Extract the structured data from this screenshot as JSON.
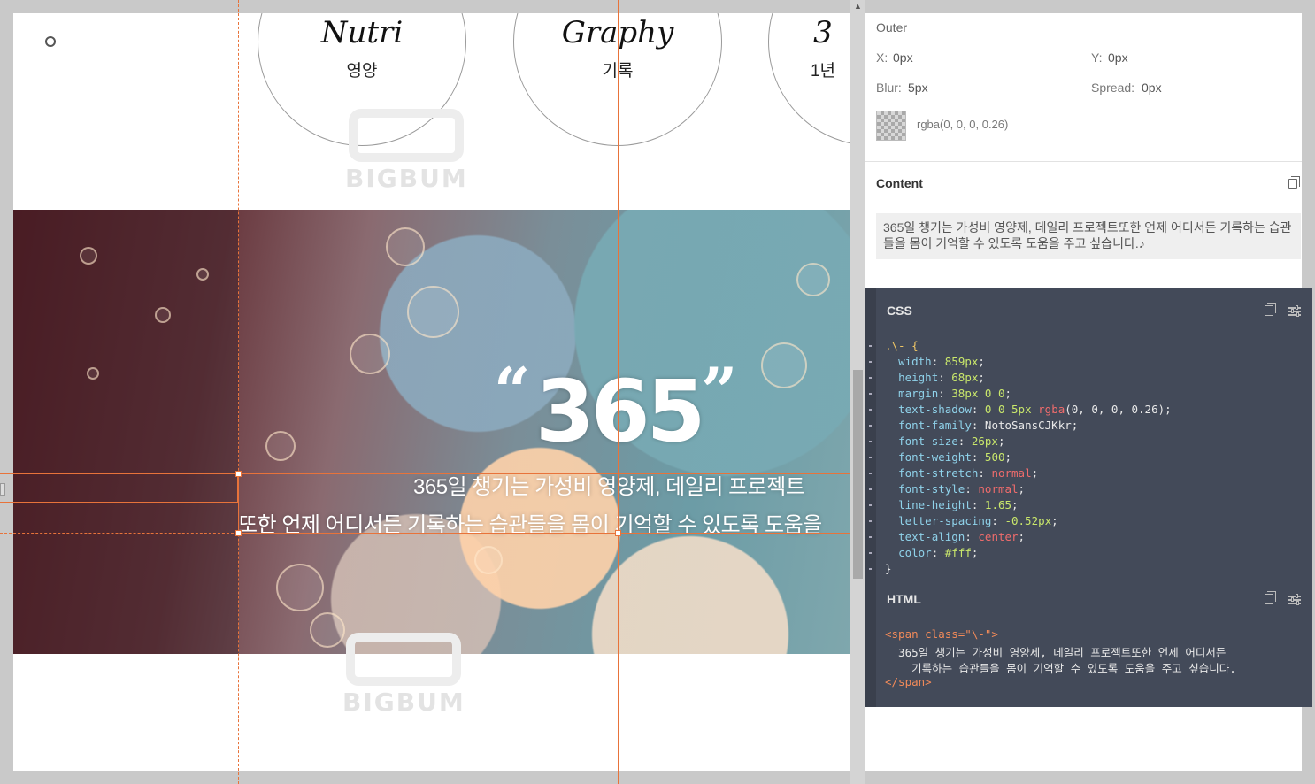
{
  "canvas": {
    "circles": [
      {
        "title": "Nutri",
        "subtitle": "영양"
      },
      {
        "title": "Graphy",
        "subtitle": "기록"
      },
      {
        "title": "3",
        "subtitle": "1년"
      }
    ],
    "watermark": "BIGBUM",
    "hero": {
      "quote_open": "“",
      "number": "365",
      "quote_close": "”",
      "line1": "365일 챙기는 가성비 영양제, 데일리 프로젝트",
      "line2": "또한 언제 어디서든 기록하는 습관들을 몸이 기억할 수 있도록 도움을"
    }
  },
  "panel": {
    "shadow": {
      "heading": "Outer",
      "x_label": "X:",
      "x_value": "0px",
      "y_label": "Y:",
      "y_value": "0px",
      "blur_label": "Blur:",
      "blur_value": "5px",
      "spread_label": "Spread:",
      "spread_value": "0px",
      "color_value": "rgba(0, 0, 0, 0.26)"
    },
    "content": {
      "heading": "Content",
      "text": "365일 챙기는 가성비 영양제, 데일리 프로젝트또한 언제 어디서든 기록하는 습관들을 몸이 기억할 수 있도록 도움을 주고 싶습니다.♪"
    },
    "css": {
      "heading": "CSS",
      "selector": ".\\- {",
      "rules": [
        {
          "prop": "width",
          "value": "859px",
          "kind": "num"
        },
        {
          "prop": "height",
          "value": "68px",
          "kind": "num"
        },
        {
          "prop": "margin",
          "value": "38px 0 0",
          "kind": "num"
        },
        {
          "prop": "text-shadow",
          "value": "0 0 5px rgba(0, 0, 0, 0.26)",
          "kind": "shadow"
        },
        {
          "prop": "font-family",
          "value": "NotoSansCJKkr",
          "kind": "plain"
        },
        {
          "prop": "font-size",
          "value": "26px",
          "kind": "num"
        },
        {
          "prop": "font-weight",
          "value": "500",
          "kind": "num"
        },
        {
          "prop": "font-stretch",
          "value": "normal",
          "kind": "kw"
        },
        {
          "prop": "font-style",
          "value": "normal",
          "kind": "kw"
        },
        {
          "prop": "line-height",
          "value": "1.65",
          "kind": "num"
        },
        {
          "prop": "letter-spacing",
          "value": "-0.52px",
          "kind": "num"
        },
        {
          "prop": "text-align",
          "value": "center",
          "kind": "kw"
        },
        {
          "prop": "color",
          "value": "#fff",
          "kind": "num"
        }
      ],
      "close": "}"
    },
    "html": {
      "heading": "HTML",
      "open_tag": "<span class=\"\\-\">",
      "body_line1": "  365일 챙기는 가성비 영양제, 데일리 프로젝트또한 언제 어디서든",
      "body_line2": "    기록하는 습관들을 몸이 기억할 수 있도록 도움을 주고 싶습니다.",
      "close_tag": "</span>"
    }
  },
  "colors": {
    "guide": "#e8733a",
    "code_bg": "#434a59"
  }
}
